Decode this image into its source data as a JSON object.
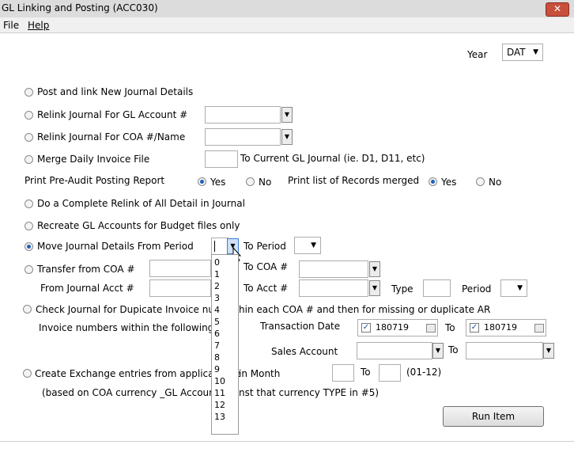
{
  "window": {
    "title": "GL Linking and Posting (ACC030)",
    "close_glyph": "✕"
  },
  "menu": {
    "file": "File",
    "help": "Help"
  },
  "year": {
    "label": "Year",
    "value": "DAT"
  },
  "options": {
    "post_link": "Post and link New Journal Details",
    "relink_gl": "Relink Journal For GL Account #",
    "relink_coa": "Relink Journal For COA #/Name",
    "merge_daily": "Merge Daily Invoice File",
    "merge_suffix": "To Current GL Journal (ie. D1, D11, etc)",
    "print_preaudit": "Print Pre-Audit Posting Report",
    "yes": "Yes",
    "no": "No",
    "print_list": "Print list of Records merged",
    "complete_relink": "Do a Complete Relink of All Detail in Journal",
    "recreate_gl": "Recreate GL Accounts for Budget files only",
    "move_journal": "Move Journal Details From Period",
    "to_period": "To Period",
    "transfer_coa": "Transfer from COA #",
    "to_coa": "To COA #",
    "from_journal_acct": "From Journal Acct #",
    "to_acct": "To Acct #",
    "type": "Type",
    "period": "Period",
    "check_journal_a": "Check Journal for Dupicate Invoice numbe",
    "check_journal_b": "hin each COA # and then for missing or duplicate AR",
    "invoice_numbers": "Invoice numbers within the following lim",
    "transaction_date": "Transaction Date",
    "to": "To",
    "sales_account": "Sales Account",
    "create_exchange_a": "Create Exchange entries from applicable re",
    "create_exchange_b": "in Month",
    "range": "(01-12)",
    "based_on_a": "(based on COA currency _GL Account/rat",
    "based_on_b": "nst that currency TYPE in #5)"
  },
  "dates": {
    "from": "180719",
    "to": "180719"
  },
  "period_list": [
    "0",
    "1",
    "2",
    "3",
    "4",
    "5",
    "6",
    "7",
    "8",
    "9",
    "10",
    "11",
    "12",
    "13"
  ],
  "run_button": "Run Item"
}
